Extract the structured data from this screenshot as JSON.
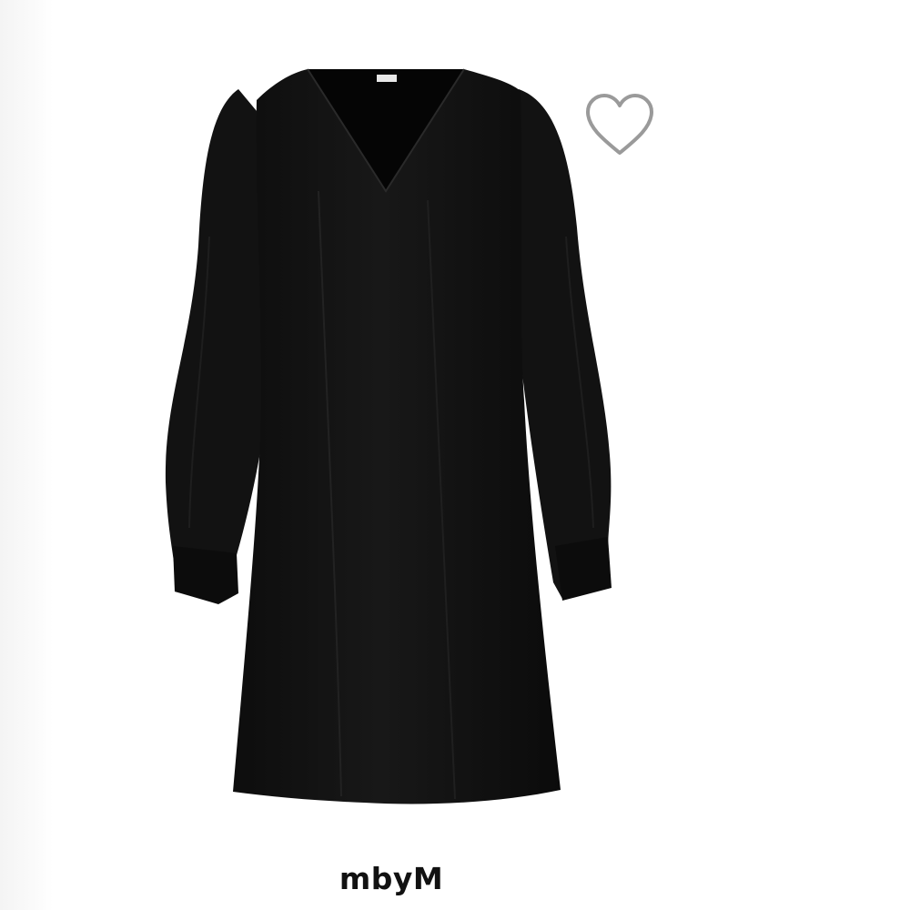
{
  "product": {
    "brand": "mbyM",
    "image_description_icon": "dress-product-image",
    "label_text": "mbyM"
  },
  "favorite": {
    "icon": "heart-outline-icon",
    "selected": false,
    "color": "#9a9a9a"
  },
  "colors": {
    "dress": "#111111",
    "background": "#ffffff"
  }
}
